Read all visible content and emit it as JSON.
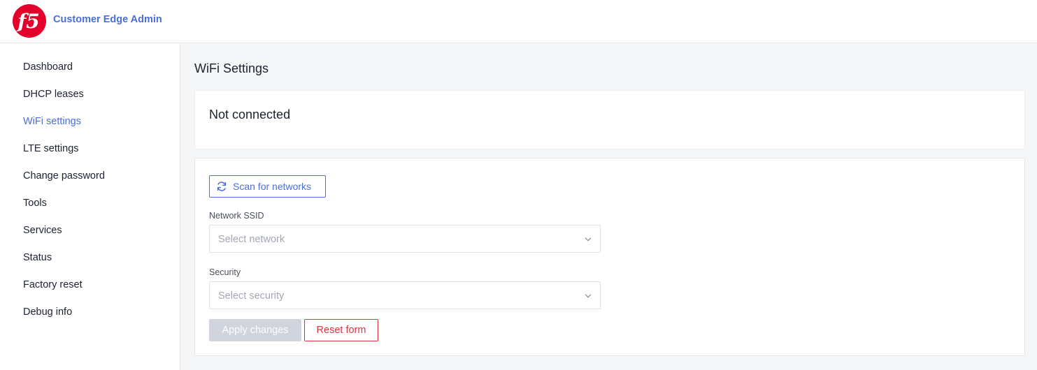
{
  "header": {
    "app_title": "Customer Edge Admin",
    "logo_text": "f5",
    "logo_color": "#e4002b"
  },
  "sidebar": {
    "items": [
      {
        "label": "Dashboard",
        "active": false
      },
      {
        "label": "DHCP leases",
        "active": false
      },
      {
        "label": "WiFi settings",
        "active": true
      },
      {
        "label": "LTE settings",
        "active": false
      },
      {
        "label": "Change password",
        "active": false
      },
      {
        "label": "Tools",
        "active": false
      },
      {
        "label": "Services",
        "active": false
      },
      {
        "label": "Status",
        "active": false
      },
      {
        "label": "Factory reset",
        "active": false
      },
      {
        "label": "Debug info",
        "active": false
      }
    ]
  },
  "main": {
    "page_title": "WiFi Settings",
    "status_text": "Not connected",
    "form": {
      "scan_button_label": "Scan for networks",
      "ssid_label": "Network SSID",
      "ssid_placeholder": "Select network",
      "security_label": "Security",
      "security_placeholder": "Select security",
      "apply_label": "Apply changes",
      "reset_label": "Reset form"
    }
  },
  "colors": {
    "accent": "#4a6fd8",
    "danger": "#d9353a",
    "disabled": "#cfd4dd"
  },
  "icons": {
    "logo": "f5-logo",
    "scan": "refresh-icon",
    "dropdown": "chevron-down-icon"
  }
}
